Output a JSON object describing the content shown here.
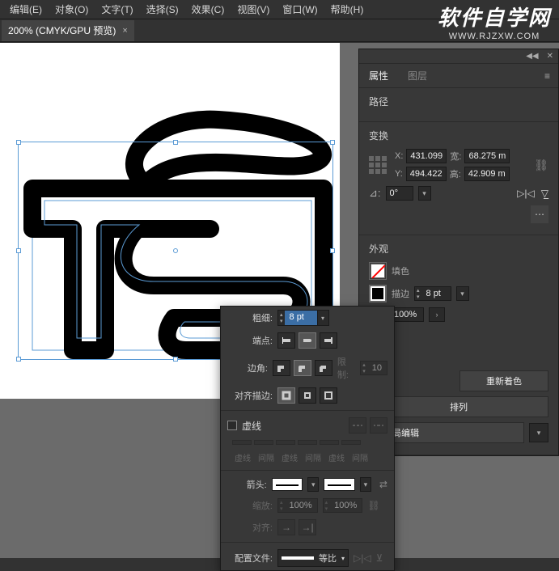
{
  "menu": {
    "edit": "编辑(E)",
    "object": "对象(O)",
    "text": "文字(T)",
    "select": "选择(S)",
    "effect": "效果(C)",
    "view": "视图(V)",
    "window": "窗口(W)",
    "help": "帮助(H)"
  },
  "watermark": {
    "title": "软件自学网",
    "url": "WWW.RJZXW.COM"
  },
  "doc_tab": {
    "label": "200% (CMYK/GPU 预览)",
    "close": "×"
  },
  "properties": {
    "tab_props": "属性",
    "tab_layers": "图层",
    "path_label": "路径",
    "transform": {
      "title": "变换",
      "x_label": "X:",
      "x": "431.099",
      "y_label": "Y:",
      "y": "494.422",
      "w_label": "宽:",
      "w": "68.275 m",
      "h_label": "高:",
      "h": "42.909 m",
      "angle": "0°"
    },
    "appearance": {
      "title": "外观",
      "fill": "填色",
      "stroke": "描边",
      "weight": "8 pt",
      "opacity": "100%",
      "recolor": "重新着色",
      "arrange": "排列",
      "global_edit": "动全局编辑"
    }
  },
  "stroke_panel": {
    "weight_label": "粗细:",
    "weight_value": "8 pt",
    "cap_label": "端点:",
    "corner_label": "边角:",
    "limit_label": "限制:",
    "limit_value": "10",
    "align_label": "对齐描边:",
    "dashed_label": "虚线",
    "dash_labels": {
      "d1": "虚线",
      "g1": "间隔",
      "d2": "虚线",
      "g2": "间隔",
      "d3": "虚线",
      "g3": "间隔"
    },
    "arrows_label": "箭头:",
    "scale_label": "缩放:",
    "scale1": "100%",
    "scale2": "100%",
    "align2_label": "对齐:",
    "profile_label": "配置文件:",
    "profile_value": "等比"
  }
}
